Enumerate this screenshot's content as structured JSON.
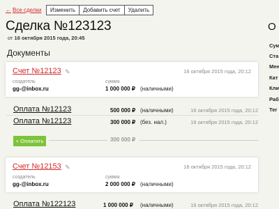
{
  "nav": {
    "back_arrow": "←",
    "back_label": "Все сделки"
  },
  "toolbar": {
    "edit": "Изменить",
    "add_invoice": "Добавить счет",
    "delete": "Удалить"
  },
  "deal": {
    "title": "Сделка №123123",
    "date_prefix": "от",
    "date": "16 октября 2015 года, 20:45"
  },
  "documents": {
    "title": "Документы",
    "invoices": [
      {
        "title": "Счет №12123",
        "date": "16 октября 2015 года, 20:12",
        "creator_label": "создатель",
        "creator": "gg-@inbox.ru",
        "amount_label": "сумма",
        "amount": "1 000 000 ₽",
        "amount_type": "(наличными)",
        "payments": [
          {
            "title": "Оплата №12123",
            "amount": "500 000 ₽",
            "type": "(наличными)",
            "date": "16 октября 2015 года, 20:12"
          },
          {
            "title": "Оплата №12123",
            "amount": "300 000 ₽",
            "type": "(без. нал.)",
            "date": "16 октября 2015 года, 20:12"
          }
        ],
        "pay_button": "+ Оплатить",
        "remaining": "300 000 ₽"
      },
      {
        "title": "Счет №12153",
        "date": "16 октября 2015 года, 20:12",
        "creator_label": "создатель",
        "creator": "gg-@inbox.ru",
        "amount_label": "сумма",
        "amount": "2 000 000 ₽",
        "amount_type": "(наличными)",
        "payments": [
          {
            "title": "Оплата №122123",
            "amount": "1 000 000 ₽",
            "type": "(наличными)",
            "date": "16 октября 2015 года, 20:12"
          }
        ]
      }
    ]
  },
  "sidebar": {
    "title": "О",
    "labels": [
      "Сум",
      "Ста",
      "Мен",
      "Кат",
      "Кли",
      "Раб",
      "Тег"
    ]
  },
  "colors": {
    "accent_red": "#d22a2a",
    "pay_green": "#7cc43a"
  },
  "icons": {
    "edit": "pencil-icon",
    "back": "arrow-left-icon"
  }
}
